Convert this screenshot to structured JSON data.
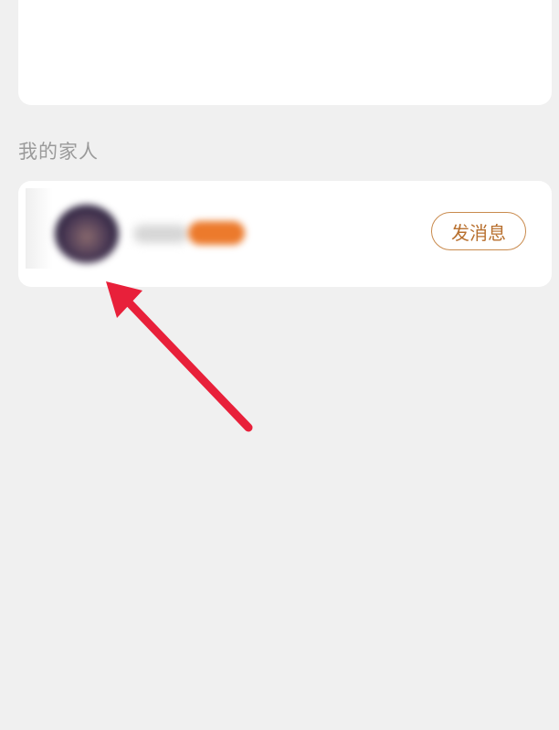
{
  "section": {
    "title": "我的家人"
  },
  "member": {
    "message_button_label": "发消息"
  },
  "annotation": {
    "arrow_color": "#e8203a"
  },
  "colors": {
    "background": "#f0f0f0",
    "card": "#ffffff",
    "accent": "#c98b4e"
  }
}
